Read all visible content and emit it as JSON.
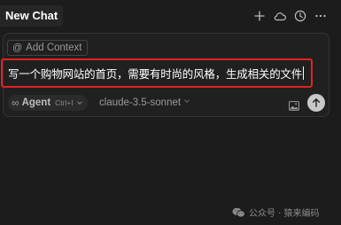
{
  "header": {
    "title": "New Chat",
    "icons": [
      "plus-icon",
      "cloud-icon",
      "history-icon",
      "more-icon"
    ]
  },
  "composer": {
    "context_label": "Add Context",
    "context_icon": "at-icon",
    "input_value": "写一个购物网站的首页，需要有时尚的风格，生成相关的文件",
    "mode": {
      "label": "Agent",
      "shortcut": "Ctrl+I",
      "icon": "infinity-icon"
    },
    "model": "claude-3.5-sonnet",
    "actions": [
      "image-icon",
      "send-arrow-up-icon"
    ]
  },
  "watermark": {
    "text": "公众号 · 猿来编码"
  },
  "colors": {
    "background": "#1c1c1c",
    "composer_bg": "#202020",
    "highlight_border": "#e32222",
    "send_button": "#c8c8c8"
  }
}
